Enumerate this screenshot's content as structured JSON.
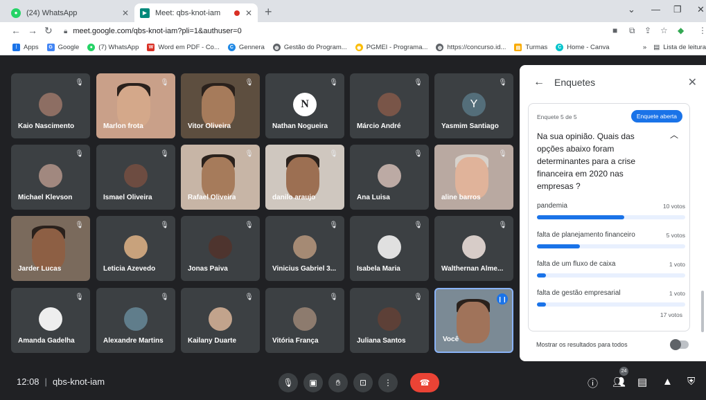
{
  "browser": {
    "tabs": [
      {
        "title": "(24) WhatsApp",
        "active": false
      },
      {
        "title": "Meet: qbs-knot-iam",
        "active": true
      }
    ],
    "url": "meet.google.com/qbs-knot-iam?pli=1&authuser=0",
    "bookmarks": [
      "Apps",
      "Google",
      "(7) WhatsApp",
      "Word em PDF - Co...",
      "Gennera",
      "Gestão do Program...",
      "PGMEI - Programa...",
      "https://concurso.id...",
      "Turmas",
      "Home - Canva",
      "»",
      "Lista de leitura"
    ]
  },
  "participants": [
    "Kaio Nascimento",
    "Marlon frota",
    "Vitor Oliveira",
    "Nathan Nogueira",
    "Márcio André",
    "Yasmim Santiago",
    "Michael Klevson",
    "Ismael Oliveira",
    "Rafael Oliveira",
    "danilo araujo",
    "Ana Luisa",
    "aline barros",
    "Jarder Lucas",
    "Leticia Azevedo",
    "Jonas Paiva",
    "Vinicius Gabriel 3...",
    "Isabela Maria",
    "Walthernan Alme...",
    "Amanda Gadelha",
    "Alexandre Martins",
    "Kailany Duarte",
    "Vitória França",
    "Juliana Santos",
    "Você"
  ],
  "avatar_letters": {
    "nathan": "N",
    "yasmim": "Y"
  },
  "panel": {
    "title": "Enquetes",
    "poll_count": "Enquete 5 de 5",
    "status": "Enquete aberta",
    "question": "Na sua opinião. Quais das opções abaixo foram determinantes para a crise financeira em 2020 nas empresas ?",
    "options": [
      {
        "label": "pandemia",
        "votes": "10 votos",
        "share": 0.59
      },
      {
        "label": "falta de planejamento financeiro",
        "votes": "5 votos",
        "share": 0.29
      },
      {
        "label": "falta de um fluxo de caixa",
        "votes": "1 voto",
        "share": 0.06
      },
      {
        "label": "falta de gestão empresarial",
        "votes": "1 voto",
        "share": 0.06
      }
    ],
    "total": "17 votos",
    "show_results_label": "Mostrar os resultados para todos"
  },
  "bottom": {
    "time": "12:08",
    "meeting_code": "qbs-knot-iam",
    "participant_count": "24"
  }
}
